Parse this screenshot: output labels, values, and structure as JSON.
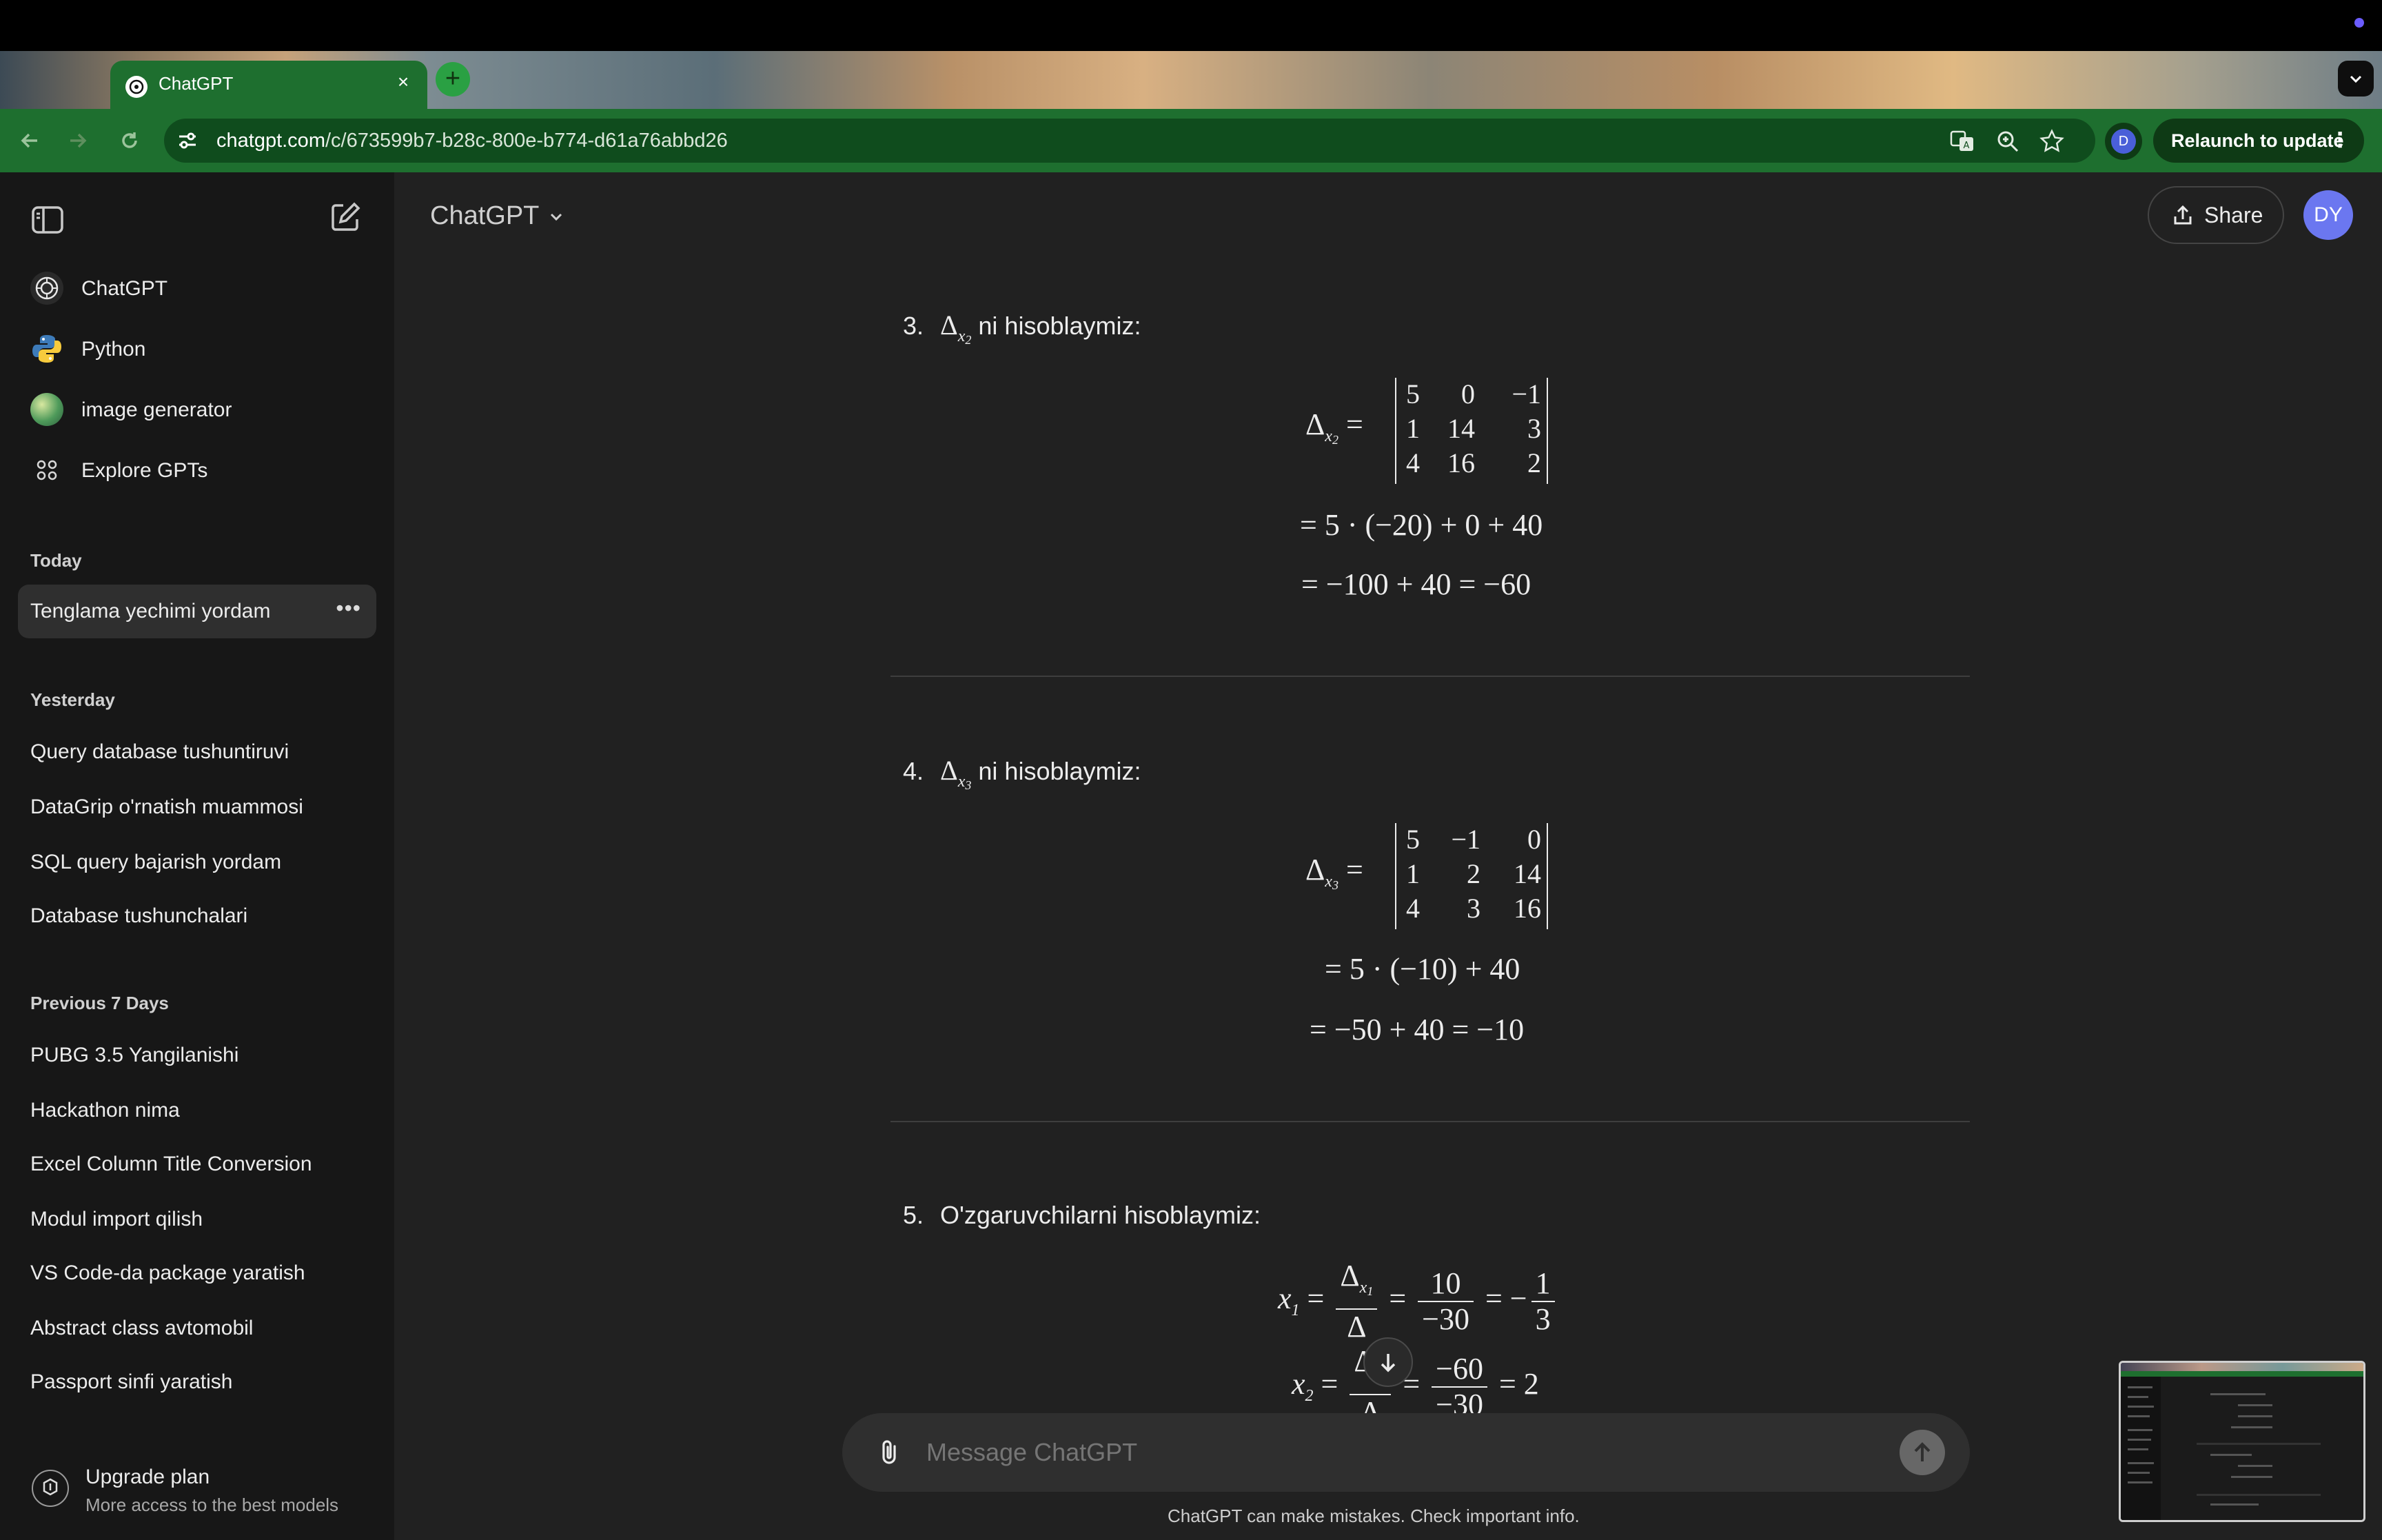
{
  "browser": {
    "tab_title": "ChatGPT",
    "url_host": "chatgpt.com",
    "url_path": "/c/673599b7-b28c-800e-b774-d61a76abbd26",
    "profile_initial": "D",
    "relaunch_label": "Relaunch to update"
  },
  "sidebar": {
    "gpts": [
      {
        "label": "ChatGPT",
        "icon": "chatgpt-logo-icon"
      },
      {
        "label": "Python",
        "icon": "python-logo-icon"
      },
      {
        "label": "image generator",
        "icon": "image-generator-icon"
      },
      {
        "label": "Explore GPTs",
        "icon": "grid-icon"
      }
    ],
    "sections": [
      {
        "title": "Today",
        "items": [
          "Tenglama yechimi yordam"
        ]
      },
      {
        "title": "Yesterday",
        "items": [
          "Query database tushuntiruvi",
          "DataGrip o'rnatish muammosi",
          "SQL query bajarish yordam",
          "Database tushunchalari"
        ]
      },
      {
        "title": "Previous 7 Days",
        "items": [
          "PUBG 3.5 Yangilanishi",
          "Hackathon nima",
          "Excel Column Title Conversion",
          "Modul import qilish",
          "VS Code-da package yaratish",
          "Abstract class avtomobil",
          "Passport sinfi yaratish"
        ]
      }
    ],
    "upgrade": {
      "title": "Upgrade plan",
      "subtitle": "More access to the best models"
    }
  },
  "header": {
    "model": "ChatGPT",
    "share_label": "Share",
    "avatar_initials": "DY"
  },
  "content": {
    "step3": {
      "num": "3.",
      "text": "ni hisoblaymiz:",
      "var": "x",
      "sub": "2",
      "matrix": [
        [
          "5",
          "0",
          "−1"
        ],
        [
          "1",
          "14",
          "3"
        ],
        [
          "4",
          "16",
          "2"
        ]
      ],
      "line1": "= 5 · (−20) + 0 + 40",
      "line2": "= −100 + 40 = −60"
    },
    "step4": {
      "num": "4.",
      "text": "ni hisoblaymiz:",
      "var": "x",
      "sub": "3",
      "matrix": [
        [
          "5",
          "−1",
          "0"
        ],
        [
          "1",
          "2",
          "14"
        ],
        [
          "4",
          "3",
          "16"
        ]
      ],
      "line1": "= 5 · (−10) + 40",
      "line2": "= −50 + 40 = −10"
    },
    "step5": {
      "num": "5.",
      "text": "O'zgaruvchilarni hisoblaymiz:",
      "x1_lhs": "x",
      "x1_sub": "1",
      "x1_num": "10",
      "x1_den": "−30",
      "x1_res_num": "1",
      "x1_res_den": "3",
      "x2_lhs": "x",
      "x2_sub": "2",
      "x2_num": "−60",
      "x2_den": "−30",
      "x2_res": "2"
    }
  },
  "composer": {
    "placeholder": "Message ChatGPT",
    "disclaimer": "ChatGPT can make mistakes. Check important info."
  }
}
